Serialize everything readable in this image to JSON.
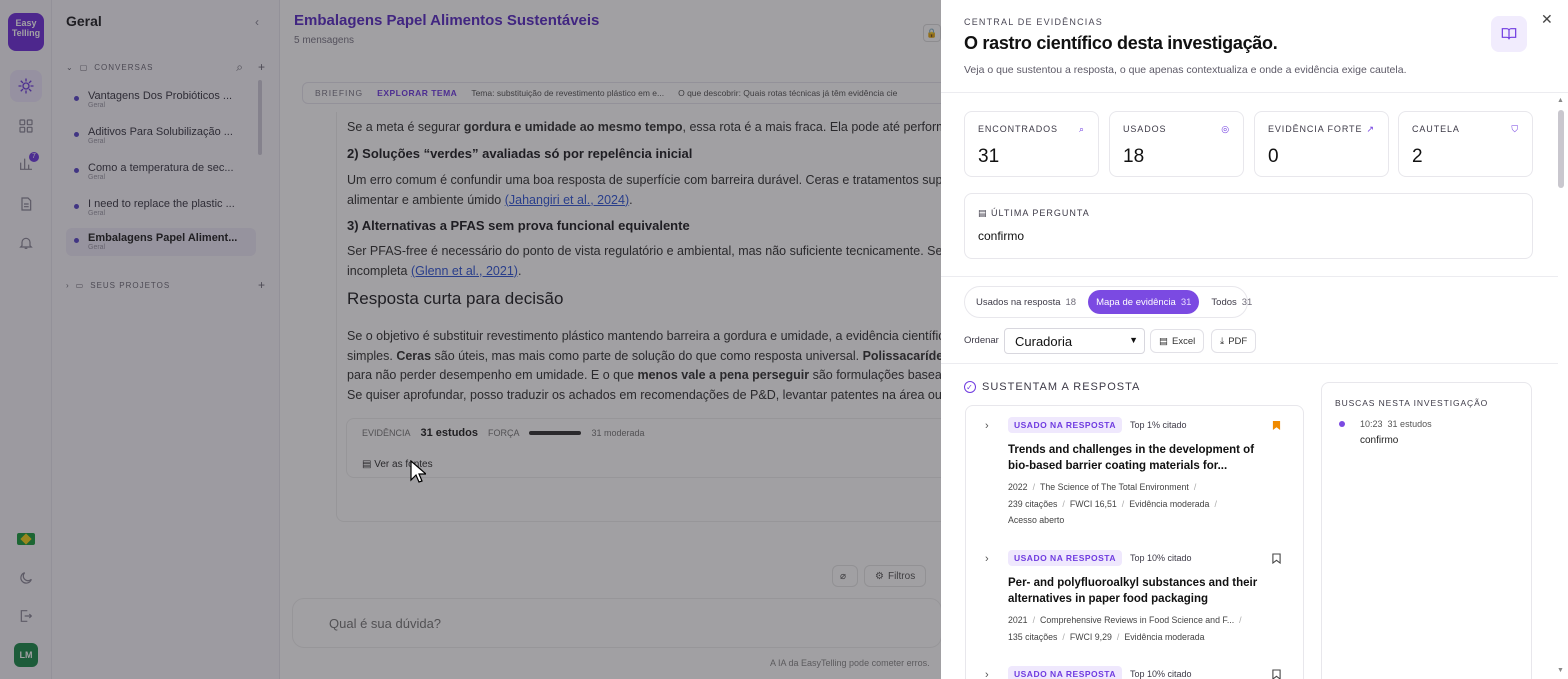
{
  "rail": {
    "logo": "Easy Telling",
    "badge": "7",
    "avatar": "LM"
  },
  "sidebar": {
    "title": "Geral",
    "conversations_header": "CONVERSAS",
    "projects_header": "SEUS PROJETOS",
    "items": [
      {
        "title": "Vantagens Dos Probióticos ...",
        "sub": "Geral"
      },
      {
        "title": "Aditivos Para Solubilização ...",
        "sub": "Geral"
      },
      {
        "title": "Como a temperatura de sec...",
        "sub": "Geral"
      },
      {
        "title": "I need to replace the plastic ...",
        "sub": "Geral"
      },
      {
        "title": "Embalagens Papel Aliment...",
        "sub": "Geral"
      }
    ]
  },
  "main": {
    "title": "Embalagens Papel Alimentos Sustentáveis",
    "subtitle": "5 mensagens",
    "briefing": {
      "label": "BRIEFING",
      "action": "EXPLORAR TEMA",
      "tema": "Tema: substituição de revestimento plástico em e...",
      "descobrir": "O que descobrir: Quais rotas técnicas já têm evidência cie"
    },
    "p1a": "Se a meta é segurar ",
    "p1b": "gordura e umidade ao mesmo tempo",
    "p1c": ", essa rota é a mais fraca. Ela pode até performar e",
    "h2a": "2) Soluções “verdes” avaliadas só por repelência inicial",
    "p2a": "Um erro comum é confundir uma boa resposta de superfície com barreira durável. Ceras e tratamentos super",
    "p2b": "alimentar e ambiente úmido ",
    "p2cite": "(Jahangiri et al., 2024)",
    "p2end": ".",
    "h2b": "3) Alternativas a PFAS sem prova funcional equivalente",
    "p3a": "Ser PFAS-free é necessário do ponto de vista regulatório e ambiental, mas não suficiente tecnicamente. Se a",
    "p3b": "incompleta ",
    "p3cite": "(Glenn et al., 2021)",
    "p3end": ".",
    "h1": "Resposta curta para decisão",
    "p4a": "Se o objetivo é substituir revestimento plástico mantendo barreira a gordura e umidade, a evidência científica",
    "p4b1": "simples. ",
    "p4b2": "Ceras",
    "p4b3": " são úteis, mas mais como parte de solução do que como resposta universal. ",
    "p4b4": "Polissacarídeos",
    "p4c1": "para não perder desempenho em umidade. E o que ",
    "p4c2": "menos vale a pena perseguir",
    "p4c3": " são formulações baseadas",
    "p4d": "Se quiser aprofundar, posso traduzir os achados em recomendações de P&D, levantar patentes na área ou co",
    "evidence": {
      "label": "EVIDÊNCIA",
      "count": "31 estudos",
      "force_label": "FORÇA",
      "force_value": "31 moderada",
      "sources": "Ver as fontes"
    },
    "filters": "Filtros",
    "input_placeholder": "Qual é sua dúvida?",
    "footer": "A IA da EasyTelling pode cometer erros."
  },
  "panel": {
    "kicker": "CENTRAL DE EVIDÊNCIAS",
    "title": "O rastro científico desta investigação.",
    "subtitle": "Veja o que sustentou a resposta, o que apenas contextualiza e onde a evidência exige cautela.",
    "stats": [
      {
        "label": "ENCONTRADOS",
        "value": "31",
        "icon": "search-icon"
      },
      {
        "label": "USADOS",
        "value": "18",
        "icon": "check-circle-icon"
      },
      {
        "label": "EVIDÊNCIA FORTE",
        "value": "0",
        "icon": "trending-up-icon"
      },
      {
        "label": "CAUTELA",
        "value": "2",
        "icon": "shield-alert-icon"
      }
    ],
    "last_question": {
      "label": "ÚLTIMA PERGUNTA",
      "value": "confirmo"
    },
    "tabs": [
      {
        "label": "Usados na resposta",
        "count": "18"
      },
      {
        "label": "Mapa de evidência",
        "count": "31"
      },
      {
        "label": "Todos",
        "count": "31"
      }
    ],
    "order_label": "Ordenar",
    "order_value": "Curadoria",
    "excel": "Excel",
    "pdf": "PDF",
    "section": "SUSTENTAM A RESPOSTA",
    "items": [
      {
        "tag": "USADO NA RESPOSTA",
        "top": "Top 1% citado",
        "title1": "Trends and challenges in the development of",
        "title2": "bio-based barrier coating materials for...",
        "year": "2022",
        "journal": "The Science of The Total Environment",
        "cites": "239 citações",
        "fwci": "FWCI 16,51",
        "evidence": "Evidência moderada",
        "access": "Acesso aberto"
      },
      {
        "tag": "USADO NA RESPOSTA",
        "top": "Top 10% citado",
        "title1": "Per- and polyfluoroalkyl substances and their",
        "title2": "alternatives in paper food packaging",
        "year": "2021",
        "journal": "Comprehensive Reviews in Food Science and F...",
        "cites": "135 citações",
        "fwci": "FWCI 9,29",
        "evidence": "Evidência moderada"
      },
      {
        "tag": "USADO NA RESPOSTA",
        "top": "Top 10% citado"
      }
    ],
    "searches": {
      "title": "BUSCAS NESTA INVESTIGAÇÃO",
      "time": "10:23",
      "studies": "31 estudos",
      "query": "confirmo"
    },
    "colors": {
      "accent": "#6f3be0",
      "bookmark_active": "#f08a00"
    }
  }
}
